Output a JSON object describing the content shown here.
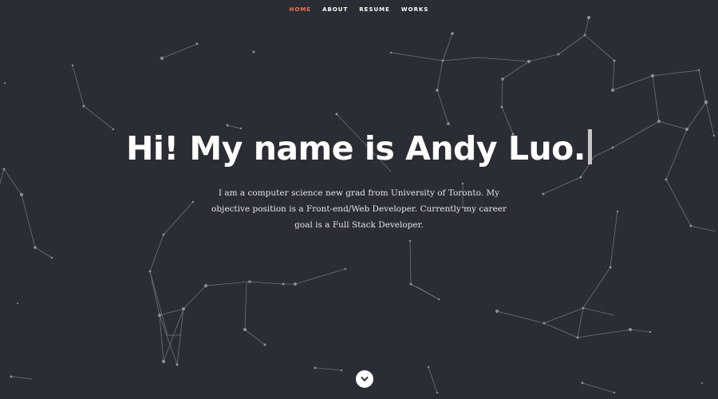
{
  "nav": {
    "items": [
      {
        "label": "HOME",
        "active": true
      },
      {
        "label": "ABOUT",
        "active": false
      },
      {
        "label": "RESUME",
        "active": false
      },
      {
        "label": "WORKS",
        "active": false
      }
    ]
  },
  "hero": {
    "heading": "Hi! My name is Andy Luo.",
    "description": "I am a computer science new grad from University of Toronto. My objective position is a Front-end/Web Developer. Currently my career goal is a Full Stack Developer."
  },
  "icons": {
    "scroll_down": "chevron-down-icon",
    "background": "particles-network"
  },
  "colors": {
    "background": "#2b2d35",
    "accent": "#f0744f",
    "text": "#ffffff"
  }
}
